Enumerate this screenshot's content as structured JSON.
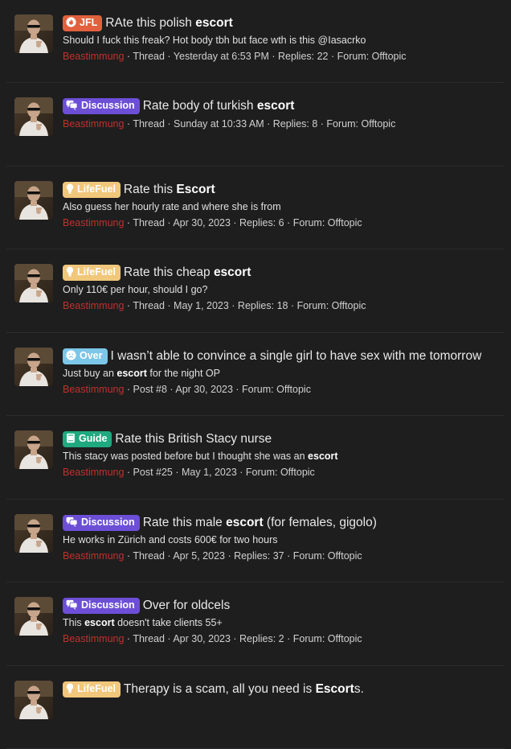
{
  "results": [
    {
      "label": {
        "text": "JFL",
        "icon": "fire-icon",
        "color": "#e2603e",
        "cls": "lbl-jfl"
      },
      "title_pre": "RAte this polish ",
      "title_bold": "escort",
      "title_post": "",
      "snippet_pre": "Should I fuck this freak? Hot body tbh but face wth is this @Iasacrko",
      "snippet_bold": "",
      "snippet_post": "",
      "user": "Beastimmung",
      "meta": " · Thread · Yesterday at 6:53 PM · Replies: 22 · Forum: Offtopic"
    },
    {
      "label": {
        "text": "Discussion",
        "icon": "chat-bubbles-icon",
        "color": "#6c4fd6",
        "cls": "lbl-disc"
      },
      "title_pre": "Rate body of turkish ",
      "title_bold": "escort",
      "title_post": "",
      "snippet_pre": "",
      "snippet_bold": "",
      "snippet_post": "",
      "user": "Beastimmung",
      "meta": " · Thread · Sunday at 10:33 AM · Replies: 8 · Forum: Offtopic"
    },
    {
      "label": {
        "text": "LifeFuel",
        "icon": "lightbulb-icon",
        "color": "#f1c77b",
        "cls": "lbl-life"
      },
      "title_pre": "Rate this ",
      "title_bold": "Escort",
      "title_post": "",
      "snippet_pre": "Also guess her hourly rate and where she is from",
      "snippet_bold": "",
      "snippet_post": "",
      "user": "Beastimmung",
      "meta": " · Thread · Apr 30, 2023 · Replies: 6 · Forum: Offtopic"
    },
    {
      "label": {
        "text": "LifeFuel",
        "icon": "lightbulb-icon",
        "color": "#f1c77b",
        "cls": "lbl-life"
      },
      "title_pre": "Rate this cheap ",
      "title_bold": "escort",
      "title_post": "",
      "snippet_pre": "Only 110€ per hour, should I go?",
      "snippet_bold": "",
      "snippet_post": "",
      "user": "Beastimmung",
      "meta": " · Thread · May 1, 2023 · Replies: 18 · Forum: Offtopic"
    },
    {
      "label": {
        "text": "Over",
        "icon": "sad-face-icon",
        "color": "#7cc6e8",
        "cls": "lbl-over"
      },
      "title_pre": "I wasn’t able to convince a single girl to have sex with me tomorrow",
      "title_bold": "",
      "title_post": "",
      "snippet_pre": "Just buy an ",
      "snippet_bold": "escort",
      "snippet_post": " for the night OP",
      "user": "Beastimmung",
      "meta": " · Post #8 · Apr 30, 2023 · Forum: Offtopic"
    },
    {
      "label": {
        "text": "Guide",
        "icon": "book-icon",
        "color": "#1fa97e",
        "cls": "lbl-guide"
      },
      "title_pre": "Rate this British Stacy nurse",
      "title_bold": "",
      "title_post": "",
      "snippet_pre": "This stacy was posted before but I thought she was an ",
      "snippet_bold": "escort",
      "snippet_post": "",
      "user": "Beastimmung",
      "meta": " · Post #25 · May 1, 2023 · Forum: Offtopic"
    },
    {
      "label": {
        "text": "Discussion",
        "icon": "chat-bubbles-icon",
        "color": "#6c4fd6",
        "cls": "lbl-disc"
      },
      "title_pre": "Rate this male ",
      "title_bold": "escort",
      "title_post": " (for females, gigolo)",
      "snippet_pre": "He works in Zürich and costs 600€ for two hours",
      "snippet_bold": "",
      "snippet_post": "",
      "user": "Beastimmung",
      "meta": " · Thread · Apr 5, 2023 · Replies: 37 · Forum: Offtopic"
    },
    {
      "label": {
        "text": "Discussion",
        "icon": "chat-bubbles-icon",
        "color": "#6c4fd6",
        "cls": "lbl-disc"
      },
      "title_pre": "Over for oldcels",
      "title_bold": "",
      "title_post": "",
      "snippet_pre": "This ",
      "snippet_bold": "escort",
      "snippet_post": " doesn't take clients 55+",
      "user": "Beastimmung",
      "meta": " · Thread · Apr 30, 2023 · Replies: 2 · Forum: Offtopic"
    },
    {
      "label": {
        "text": "LifeFuel",
        "icon": "lightbulb-icon",
        "color": "#f1c77b",
        "cls": "lbl-life"
      },
      "title_pre": "Therapy is a scam, all you need is ",
      "title_bold": "Escort",
      "title_post": "s.",
      "snippet_pre": "",
      "snippet_bold": "",
      "snippet_post": "",
      "user": "",
      "meta": ""
    }
  ]
}
